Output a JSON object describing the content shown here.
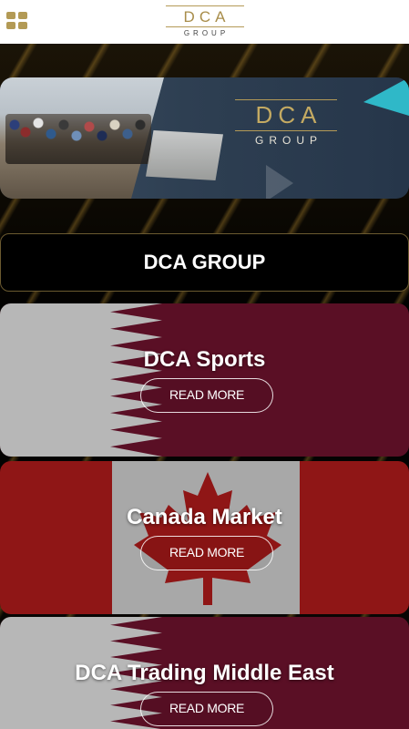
{
  "header": {
    "logo_primary": "DCA",
    "logo_secondary": "GROUP",
    "menu_icon": "grid-menu-icon",
    "accent_color": "#b39a55"
  },
  "banner": {
    "logo_primary": "DCA",
    "logo_secondary": "GROUP"
  },
  "group_button": {
    "label": "DCA GROUP"
  },
  "cards": [
    {
      "title": "DCA Sports",
      "button": "READ MORE",
      "flag": "qatar"
    },
    {
      "title": "Canada Market",
      "button": "READ MORE",
      "flag": "canada"
    },
    {
      "title": "DCA Trading Middle East",
      "button": "READ MORE",
      "flag": "qatar"
    }
  ],
  "colors": {
    "qatar_maroon": "#5a0f25",
    "qatar_light": "#b7b7b7",
    "canada_red": "#8f1616",
    "canada_light": "#a8a8a8"
  }
}
